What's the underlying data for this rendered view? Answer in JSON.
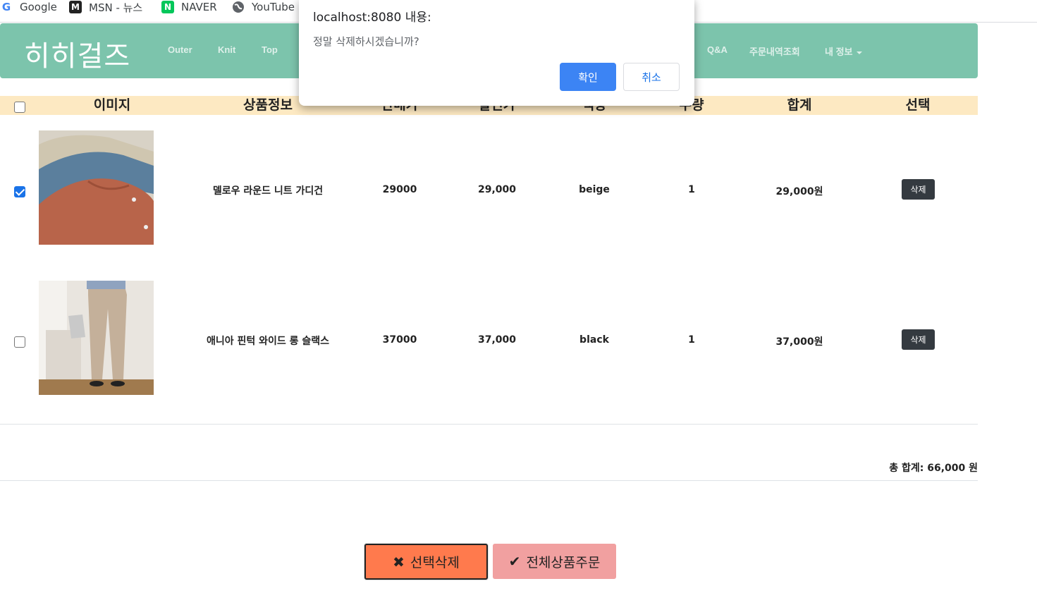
{
  "bookmarks": [
    {
      "label": "Google",
      "icon": "google-icon"
    },
    {
      "label": "MSN - 뉴스",
      "icon": "msn-icon"
    },
    {
      "label": "NAVER",
      "icon": "naver-icon"
    },
    {
      "label": "YouTube",
      "icon": "globe-icon"
    }
  ],
  "navbar": {
    "brand": "히히걸즈",
    "links": [
      "Outer",
      "Knit",
      "Top",
      "Q&A",
      "주문내역조회",
      "내 정보"
    ],
    "bg_color": "#7cc4ac"
  },
  "table": {
    "headers": [
      "이미지",
      "상품정보",
      "판매가",
      "할인가",
      "색상",
      "수량",
      "합계",
      "선택"
    ],
    "header_bg": "#fde9c2",
    "rows": [
      {
        "checked": true,
        "name": "델로우 라운드 니트 가디건",
        "price": "29000",
        "sale_price": "29,000",
        "color": "beige",
        "qty": "1",
        "total": "29,000원",
        "action": "삭제"
      },
      {
        "checked": false,
        "name": "애니아 핀턱 와이드 롱 슬랙스",
        "price": "37000",
        "sale_price": "37,000",
        "color": "black",
        "qty": "1",
        "total": "37,000원",
        "action": "삭제"
      }
    ]
  },
  "summary": {
    "total_label": "총 합계: 66,000 원"
  },
  "buttons": {
    "delete_selected": "선택삭제",
    "order_all": "전체상품주문",
    "delete_selected_color": "#ff7a4d",
    "order_all_color": "#f1a0a0"
  },
  "dialog": {
    "title": "localhost:8080 내용:",
    "message": "정말 삭제하시겠습니까?",
    "ok": "확인",
    "cancel": "취소",
    "ok_color": "#3c84f4"
  }
}
